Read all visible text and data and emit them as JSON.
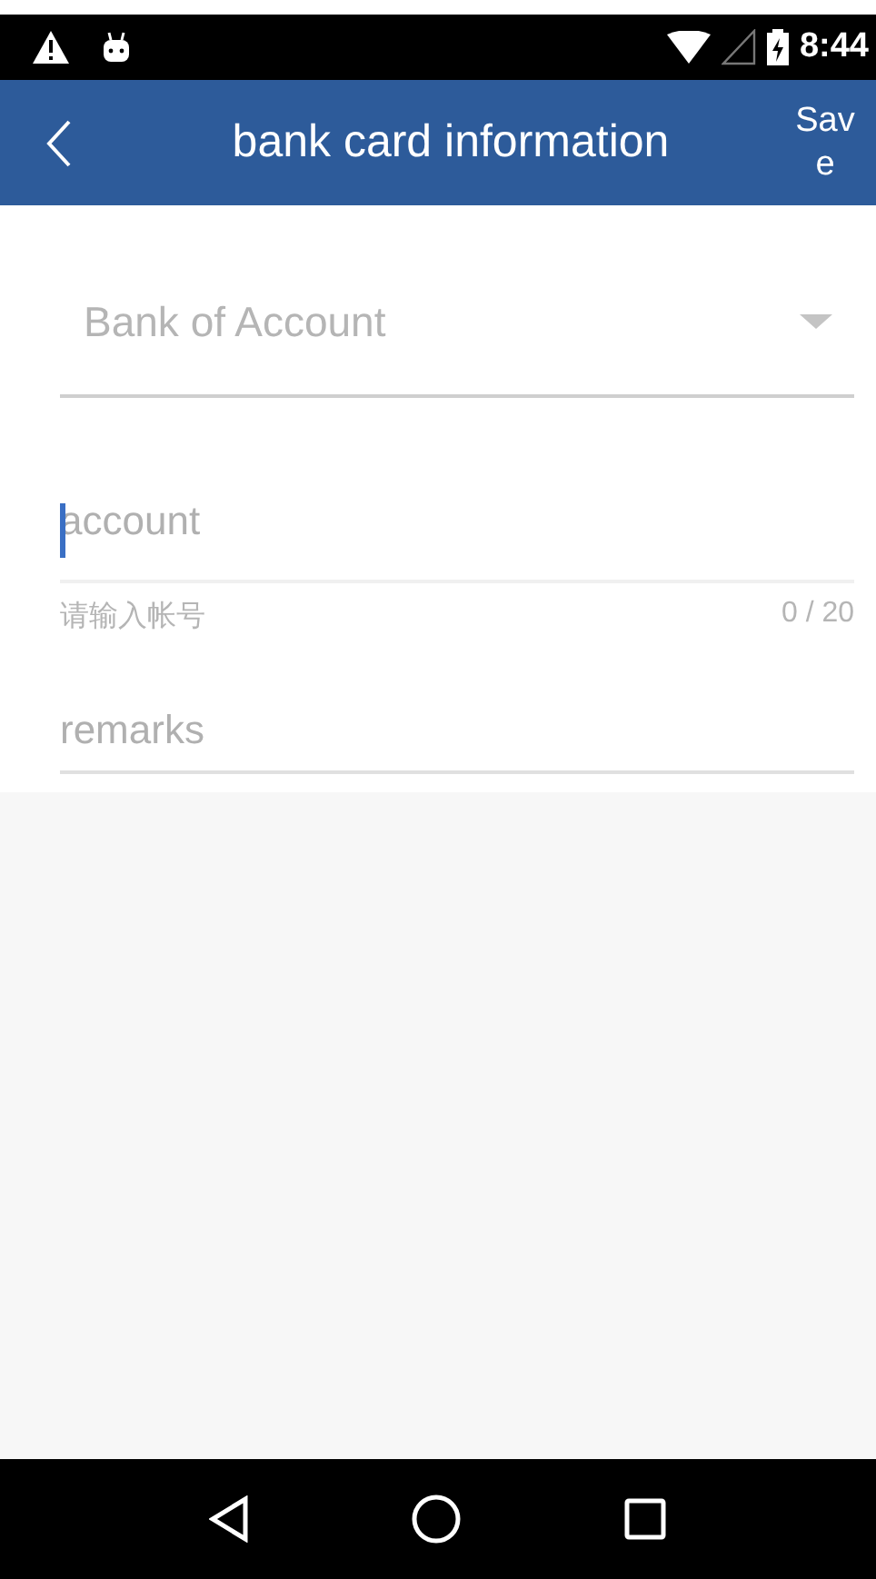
{
  "status_bar": {
    "time": "8:44"
  },
  "app_bar": {
    "title": "bank card information",
    "action": "Sav e"
  },
  "form": {
    "bank": {
      "placeholder": "Bank of Account"
    },
    "account": {
      "placeholder": "account",
      "focused": true,
      "helper": "请输入帐号",
      "counter": "0 / 20"
    },
    "remarks": {
      "placeholder": "remarks"
    }
  }
}
